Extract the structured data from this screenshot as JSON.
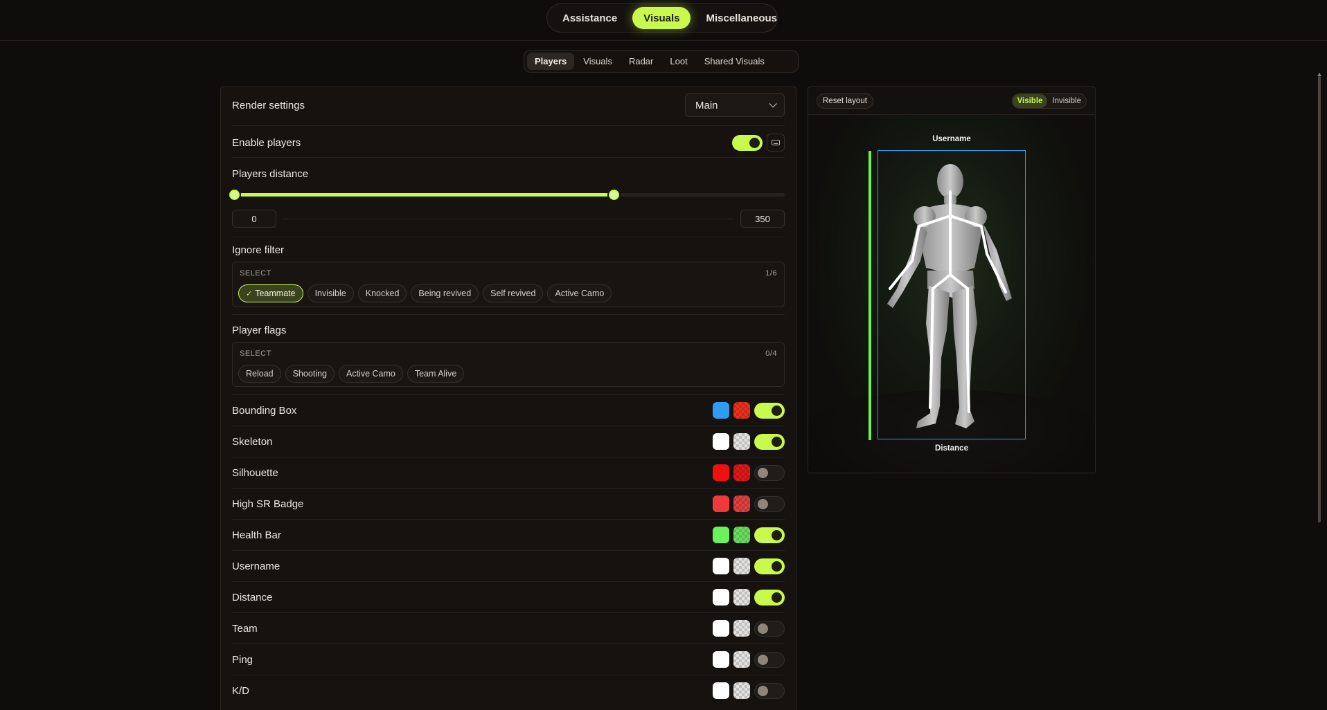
{
  "top_tabs": [
    {
      "label": "Assistance",
      "active": false
    },
    {
      "label": "Visuals",
      "active": true
    },
    {
      "label": "Miscellaneous",
      "active": false
    }
  ],
  "sub_tabs": [
    {
      "label": "Players",
      "active": true
    },
    {
      "label": "Visuals",
      "active": false
    },
    {
      "label": "Radar",
      "active": false
    },
    {
      "label": "Loot",
      "active": false
    },
    {
      "label": "Shared Visuals",
      "active": false
    }
  ],
  "render_settings": {
    "label": "Render settings",
    "value": "Main"
  },
  "enable_players": {
    "label": "Enable players",
    "enabled": true
  },
  "players_distance": {
    "label": "Players distance",
    "min": "0",
    "max": "350",
    "slider_fraction": 0.69
  },
  "ignore_filter": {
    "label": "Ignore filter",
    "select_label": "SELECT",
    "count": "1/6",
    "options": [
      {
        "label": "Teammate",
        "selected": true
      },
      {
        "label": "Invisible",
        "selected": false
      },
      {
        "label": "Knocked",
        "selected": false
      },
      {
        "label": "Being revived",
        "selected": false
      },
      {
        "label": "Self revived",
        "selected": false
      },
      {
        "label": "Active Camo",
        "selected": false
      }
    ]
  },
  "player_flags": {
    "label": "Player flags",
    "select_label": "SELECT",
    "count": "0/4",
    "options": [
      {
        "label": "Reload",
        "selected": false
      },
      {
        "label": "Shooting",
        "selected": false
      },
      {
        "label": "Active Camo",
        "selected": false
      },
      {
        "label": "Team Alive",
        "selected": false
      }
    ]
  },
  "features": [
    {
      "label": "Bounding Box",
      "color1": "#2f9bf3",
      "color2": "#e8321e",
      "enabled": true
    },
    {
      "label": "Skeleton",
      "color1": "#ffffff",
      "color2": "#e2e2e2",
      "enabled": true
    },
    {
      "label": "Silhouette",
      "color1": "#f01010",
      "color2": "#e01818",
      "enabled": false
    },
    {
      "label": "High SR Badge",
      "color1": "#f03a3a",
      "color2": "#e24040",
      "enabled": false
    },
    {
      "label": "Health Bar",
      "color1": "#6bf25a",
      "color2": "#6adf5e",
      "enabled": true
    },
    {
      "label": "Username",
      "color1": "#ffffff",
      "color2": "#e2e2e2",
      "enabled": true
    },
    {
      "label": "Distance",
      "color1": "#ffffff",
      "color2": "#e2e2e2",
      "enabled": true
    },
    {
      "label": "Team",
      "color1": "#ffffff",
      "color2": "#e2e2e2",
      "enabled": false
    },
    {
      "label": "Ping",
      "color1": "#ffffff",
      "color2": "#e2e2e2",
      "enabled": false
    },
    {
      "label": "K/D",
      "color1": "#ffffff",
      "color2": "#e2e2e2",
      "enabled": false
    }
  ],
  "preview": {
    "reset_label": "Reset layout",
    "visible_label": "Visible",
    "invisible_label": "Invisible",
    "username_label": "Username",
    "distance_label": "Distance"
  },
  "colors": {
    "accent": "#c9f94c",
    "background": "#0f0d0b"
  }
}
